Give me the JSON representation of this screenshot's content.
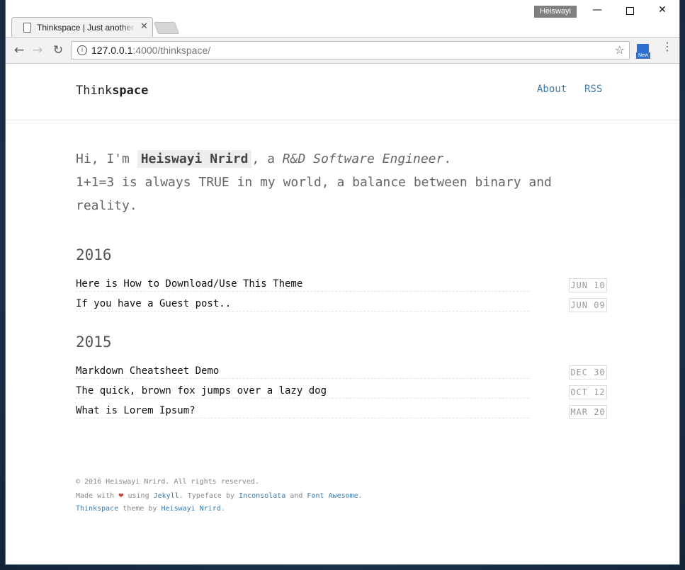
{
  "browser": {
    "tab_title": "Thinkspace | Just another",
    "tab_close": "✕",
    "profile_name": "Heiswayi",
    "url_host": "127.0.0.1",
    "url_path": ":4000/thinkspace/",
    "ext_badge": "New",
    "icons": [
      "back-icon",
      "forward-icon",
      "reload-icon",
      "info-icon",
      "star-icon",
      "menu-icon"
    ]
  },
  "site": {
    "brand_part1": "Think",
    "brand_part2": "space",
    "nav": {
      "about": "About",
      "rss": "RSS"
    },
    "intro": {
      "greeting": "Hi, I'm ",
      "name": "Heiswayi Nrird",
      "mid": ", a ",
      "role": "R&D Software Engineer",
      "end": ".",
      "line2": "1+1=3 is always TRUE in my world, a balance between binary and reality."
    },
    "years": [
      {
        "year": "2016",
        "posts": [
          {
            "title": "Here is How to Download/Use This Theme",
            "date": "JUN 10"
          },
          {
            "title": "If you have a Guest post..",
            "date": "JUN 09"
          }
        ]
      },
      {
        "year": "2015",
        "posts": [
          {
            "title": "Markdown Cheatsheet Demo",
            "date": "DEC 30"
          },
          {
            "title": "The quick, brown fox jumps over a lazy dog",
            "date": "OCT 12"
          },
          {
            "title": "What is Lorem Ipsum?",
            "date": "MAR 20"
          }
        ]
      }
    ],
    "footer": {
      "copyright": "© 2016 Heiswayi Nrird. All rights reserved.",
      "made_with": "Made with",
      "using": "using",
      "jekyll": "Jekyll",
      "typeface_by": ". Typeface by",
      "inconsolata": "Inconsolata",
      "and": "and",
      "font_awesome": "Font Awesome",
      "period": ".",
      "theme_name": "Thinkspace",
      "theme_by": "theme by",
      "author": "Heiswayi Nrird"
    }
  }
}
